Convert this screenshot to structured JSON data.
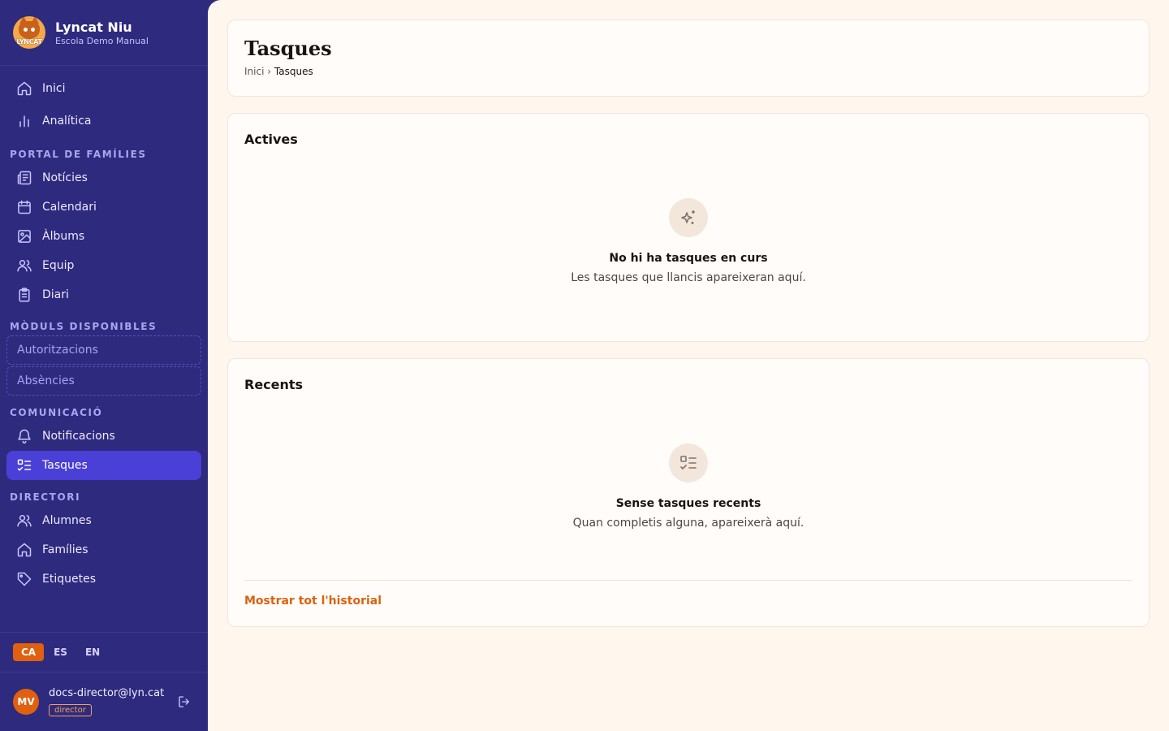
{
  "brand": {
    "name": "Lyncat Niu",
    "subtitle": "Escola Demo Manual",
    "logo_text": "LYNCAT"
  },
  "nav_top": [
    {
      "label": "Inici",
      "icon": "home-icon"
    },
    {
      "label": "Analítica",
      "icon": "bar-chart-icon"
    }
  ],
  "sections": {
    "families": {
      "label": "PORTAL DE FAMÍLIES",
      "items": [
        {
          "label": "Notícies",
          "icon": "newspaper-icon"
        },
        {
          "label": "Calendari",
          "icon": "calendar-icon"
        },
        {
          "label": "Àlbums",
          "icon": "image-icon"
        },
        {
          "label": "Equip",
          "icon": "users-icon"
        },
        {
          "label": "Diari",
          "icon": "clipboard-icon"
        }
      ]
    },
    "modules": {
      "label": "MÒDULS DISPONIBLES",
      "items": [
        {
          "label": "Autoritzacions"
        },
        {
          "label": "Absències"
        }
      ]
    },
    "communication": {
      "label": "COMUNICACIÓ",
      "items": [
        {
          "label": "Notificacions",
          "icon": "bell-icon"
        },
        {
          "label": "Tasques",
          "icon": "tasks-icon",
          "active": true
        }
      ]
    },
    "directory": {
      "label": "DIRECTORI",
      "items": [
        {
          "label": "Alumnes",
          "icon": "users-icon"
        },
        {
          "label": "Famílies",
          "icon": "home-icon"
        },
        {
          "label": "Etiquetes",
          "icon": "tag-icon"
        }
      ]
    }
  },
  "languages": [
    {
      "code": "CA",
      "active": true
    },
    {
      "code": "ES"
    },
    {
      "code": "EN"
    }
  ],
  "user": {
    "initials": "MV",
    "email": "docs-director@lyn.cat",
    "role": "director"
  },
  "page": {
    "title": "Tasques",
    "breadcrumb": {
      "home": "Inici",
      "separator": "›",
      "current": "Tasques"
    }
  },
  "active_card": {
    "title": "Actives",
    "empty_title": "No hi ha tasques en curs",
    "empty_sub": "Les tasques que llancis apareixeran aquí."
  },
  "recent_card": {
    "title": "Recents",
    "empty_title": "Sense tasques recents",
    "empty_sub": "Quan completis alguna, apareixerà aquí.",
    "history_link": "Mostrar tot l'historial"
  },
  "colors": {
    "sidebar": "#2e2a7e",
    "active_nav": "#4a3fd6",
    "accent": "#e0600f",
    "main_bg": "#fff6ee"
  }
}
